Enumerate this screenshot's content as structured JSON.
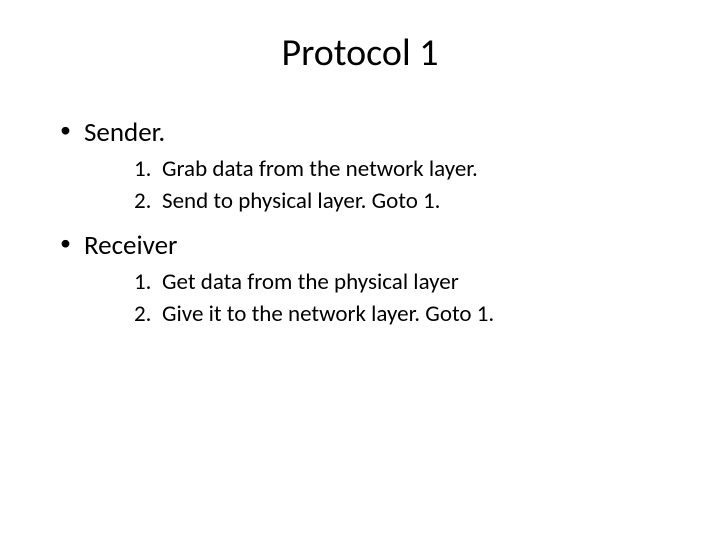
{
  "title": "Protocol 1",
  "sections": [
    {
      "label": "Sender.",
      "steps": [
        "Grab data from the network layer.",
        "Send to physical layer. Goto 1."
      ]
    },
    {
      "label": "Receiver",
      "steps": [
        "Get data from the physical layer",
        "Give it to the network layer. Goto 1."
      ]
    }
  ]
}
